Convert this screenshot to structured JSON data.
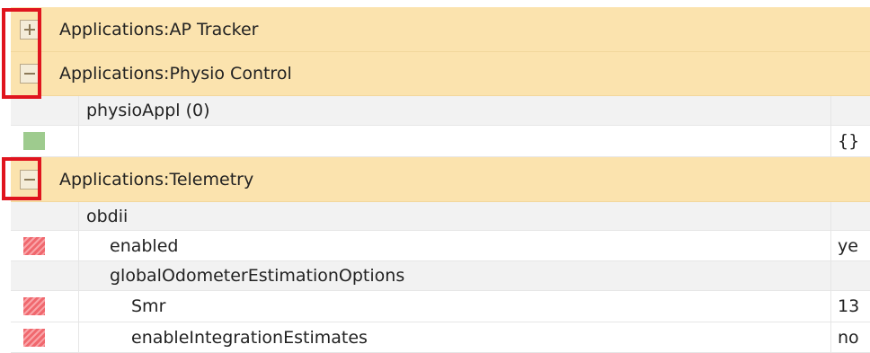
{
  "groups": [
    {
      "label": "Applications:AP Tracker",
      "state": "collapsed",
      "toggle_icon": "plus-icon"
    },
    {
      "label": "Applications:Physio Control",
      "state": "expanded",
      "toggle_icon": "minus-icon"
    },
    {
      "label": "Applications:Telemetry",
      "state": "expanded",
      "toggle_icon": "minus-icon"
    }
  ],
  "physio": {
    "section": "physioAppl (0)",
    "row_value": "{}",
    "row_status": "ok"
  },
  "telemetry": {
    "section": "obdii",
    "rows": [
      {
        "label": "enabled",
        "value": "ye",
        "status": "error"
      },
      {
        "label": "globalOdometerEstimationOptions",
        "value": "",
        "status": "none"
      },
      {
        "label": "Smr",
        "value": "13",
        "status": "error"
      },
      {
        "label": "enableIntegrationEstimates",
        "value": "no",
        "status": "error"
      }
    ]
  },
  "colors": {
    "group_bg": "#fbe3ae",
    "highlight": "#e0141e",
    "status_ok": "#9ecb8e",
    "status_error": "#f0686e"
  }
}
